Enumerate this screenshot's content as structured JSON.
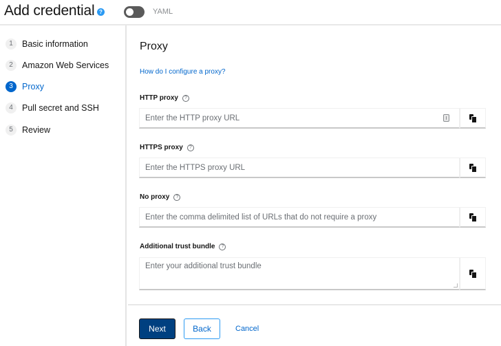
{
  "header": {
    "title": "Add credential",
    "help_icon": "help-circle-icon",
    "yaml_toggle": {
      "label": "YAML",
      "on": false
    }
  },
  "wizard_steps": [
    {
      "number": "1",
      "label": "Basic information",
      "current": false
    },
    {
      "number": "2",
      "label": "Amazon Web Services",
      "current": false
    },
    {
      "number": "3",
      "label": "Proxy",
      "current": true
    },
    {
      "number": "4",
      "label": "Pull secret and SSH",
      "current": false
    },
    {
      "number": "5",
      "label": "Review",
      "current": false
    }
  ],
  "main": {
    "section_title": "Proxy",
    "help_link": "How do I configure a proxy?",
    "fields": [
      {
        "label": "HTTP proxy",
        "placeholder": "Enter the HTTP proxy URL",
        "value": ""
      },
      {
        "label": "HTTPS proxy",
        "placeholder": "Enter the HTTPS proxy URL",
        "value": ""
      },
      {
        "label": "No proxy",
        "placeholder": "Enter the comma delimited list of URLs that do not require a proxy",
        "value": ""
      },
      {
        "label": "Additional trust bundle",
        "placeholder": "Enter your additional trust bundle",
        "value": ""
      }
    ],
    "help_glyph": "?"
  },
  "footer": {
    "next_label": "Next",
    "back_label": "Back",
    "cancel_label": "Cancel"
  },
  "colors": {
    "primary": "#0066cc",
    "primary_dark": "#004080",
    "help_blue": "#2b9af3"
  }
}
